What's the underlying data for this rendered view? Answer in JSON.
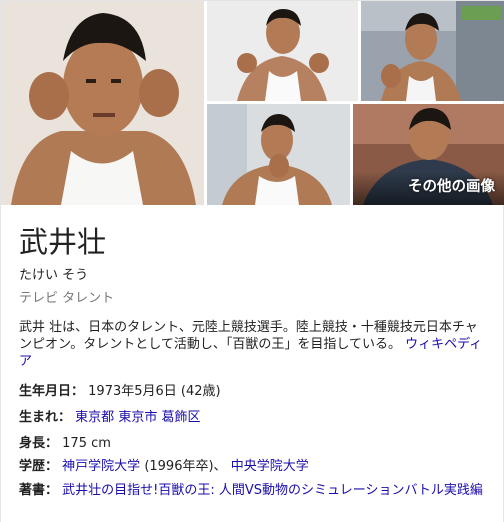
{
  "gallery": {
    "more_images_label": "その他の画像"
  },
  "entity": {
    "name": "武井壮",
    "reading": "たけい そう",
    "subtitle": "テレビ タレント",
    "description": "武井 壮は、日本のタレント、元陸上競技選手。陸上競技・十種競技元日本チャンピオン。タレントとして活動し、「百獣の王」を目指している。",
    "source_link": "ウィキペディア"
  },
  "facts": {
    "birthdate": {
      "label": "生年月日：",
      "value": "1973年5月6日 (42歳)"
    },
    "birthplace": {
      "label": "生まれ：",
      "link1": "東京都",
      "link2": "東京市",
      "link3": "葛飾区"
    },
    "height": {
      "label": "身長：",
      "value": "175 cm"
    },
    "education": {
      "label": "学歴：",
      "link1": "神戸学院大学",
      "suffix1": "(1996年卒)、",
      "link2": "中央学院大学"
    },
    "books": {
      "label": "著書：",
      "link1": "武井壮の目指せ!百獣の王: 人間VS動物のシミュレーションバトル実践編"
    }
  }
}
